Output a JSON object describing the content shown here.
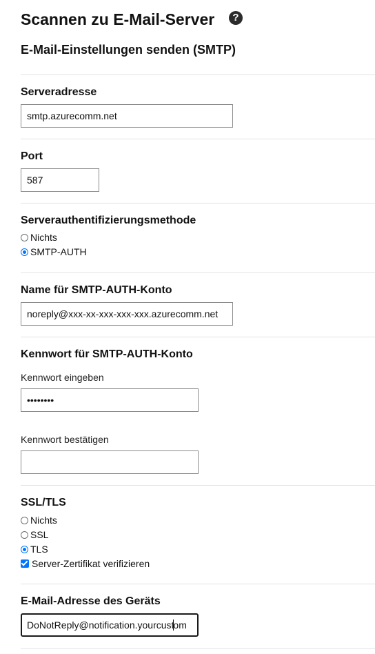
{
  "page": {
    "title": "Scannen zu E-Mail-Server",
    "help_icon": "?",
    "subtitle": "E-Mail-Einstellungen senden (SMTP)"
  },
  "server_address": {
    "label": "Serveradresse",
    "value": "smtp.azurecomm.net"
  },
  "port": {
    "label": "Port",
    "value": "587"
  },
  "auth_method": {
    "label": "Serverauthentifizierungsmethode",
    "options": [
      "Nichts",
      "SMTP-AUTH"
    ],
    "selected": "SMTP-AUTH"
  },
  "smtp_account": {
    "label": "Name für SMTP-AUTH-Konto",
    "value": "noreply@xxx-xx-xxx-xxx-xxx.azurecomm.net"
  },
  "smtp_password": {
    "label": "Kennwort für SMTP-AUTH-Konto",
    "enter_label": "Kennwort eingeben",
    "enter_value": "••••••••",
    "confirm_label": "Kennwort bestätigen",
    "confirm_value": ""
  },
  "ssl_tls": {
    "label": "SSL/TLS",
    "options": [
      "Nichts",
      "SSL",
      "TLS"
    ],
    "selected": "TLS",
    "verify_cert_label": "Server-Zertifikat verifizieren",
    "verify_cert_checked": true
  },
  "device_email": {
    "label": "E-Mail-Adresse des Geräts",
    "value_before_caret": "DoNotReply@notification.yourcust",
    "value_after_caret": "om"
  },
  "colors": {
    "accent": "#0075ff",
    "divider": "#e2e2e2"
  }
}
